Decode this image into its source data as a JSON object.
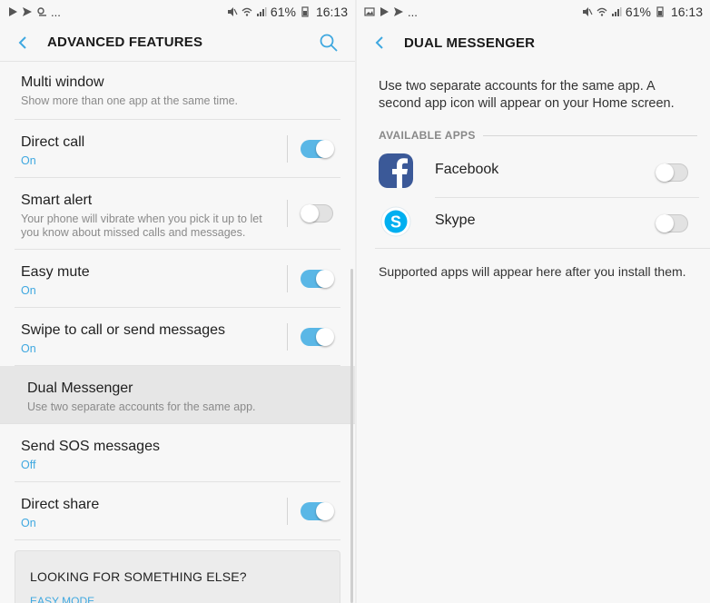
{
  "left": {
    "status": {
      "battery": "61%",
      "time": "16:13",
      "more": "..."
    },
    "title": "ADVANCED FEATURES",
    "items": [
      {
        "title": "Multi window",
        "sub": "Show more than one app at the same time."
      },
      {
        "title": "Direct call",
        "sub": "On",
        "toggle": true
      },
      {
        "title": "Smart alert",
        "sub": "Your phone will vibrate when you pick it up to let you know about missed calls and messages.",
        "toggle": false
      },
      {
        "title": "Easy mute",
        "sub": "On",
        "toggle": true
      },
      {
        "title": "Swipe to call or send messages",
        "sub": "On",
        "toggle": true
      },
      {
        "title": "Dual Messenger",
        "sub": "Use two separate accounts for the same app."
      },
      {
        "title": "Send SOS messages",
        "sub": "Off"
      },
      {
        "title": "Direct share",
        "sub": "On",
        "toggle": true
      }
    ],
    "looking": {
      "title": "LOOKING FOR SOMETHING ELSE?",
      "link": "EASY MODE"
    }
  },
  "right": {
    "status": {
      "battery": "61%",
      "time": "16:13",
      "more": "..."
    },
    "title": "DUAL MESSENGER",
    "description": "Use two separate accounts for the same app. A second app icon will appear on your Home screen.",
    "section": "AVAILABLE APPS",
    "apps": [
      {
        "name": "Facebook",
        "icon": "facebook-icon",
        "enabled": false
      },
      {
        "name": "Skype",
        "icon": "skype-icon",
        "enabled": false
      }
    ],
    "note": "Supported apps will appear here after you install them."
  },
  "colors": {
    "accent": "#3fa8e0",
    "toggle_on": "#5ab7e6",
    "facebook": "#3b5998",
    "skype": "#00aff0"
  }
}
